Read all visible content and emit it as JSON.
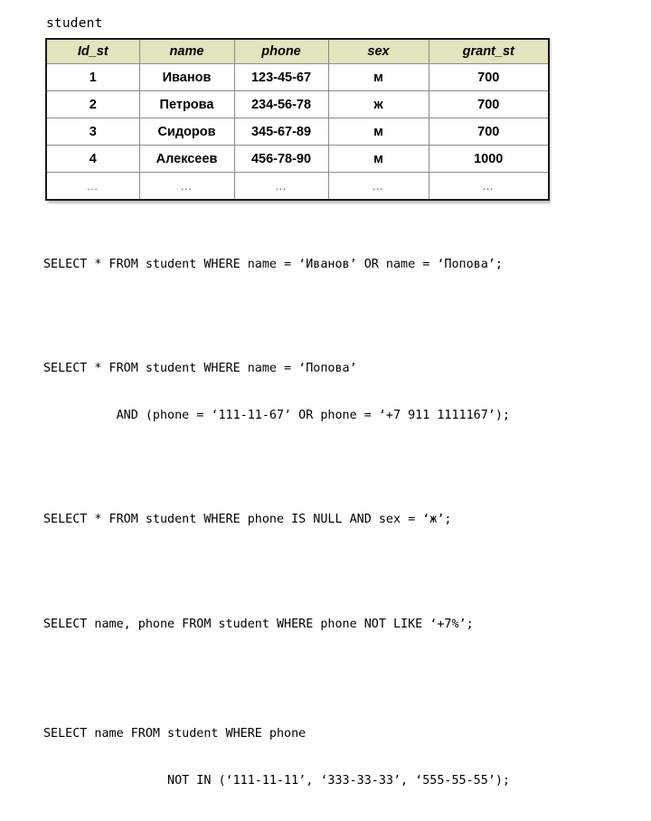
{
  "table": {
    "caption": "student",
    "columns": [
      "Id_st",
      "name",
      "phone",
      "sex",
      "grant_st"
    ],
    "rows": [
      [
        "1",
        "Иванов",
        "123-45-67",
        "м",
        "700"
      ],
      [
        "2",
        "Петрова",
        "234-56-78",
        "ж",
        "700"
      ],
      [
        "3",
        "Сидоров",
        "345-67-89",
        "м",
        "700"
      ],
      [
        "4",
        "Алексеев",
        "456-78-90",
        "м",
        "1000"
      ],
      [
        "…",
        "…",
        "…",
        "…",
        "…"
      ]
    ],
    "header_bg": "#e3e3bd",
    "border_color": "#1a1a1a",
    "cell_border_color": "#8a8a8a"
  },
  "sql": {
    "statements": [
      {
        "id": "stmt-1",
        "lines": [
          "SELECT * FROM student WHERE name = ‘Иванов’ OR name = ‘Попова’;"
        ]
      },
      {
        "id": "stmt-2",
        "lines": [
          "SELECT * FROM student WHERE name = ‘Попова’",
          "          AND (phone = ‘111-11-67’ OR phone = ‘+7 911 1111167’);"
        ]
      },
      {
        "id": "stmt-3",
        "lines": [
          "SELECT * FROM student WHERE phone IS NULL AND sex = ‘ж’;"
        ]
      },
      {
        "id": "stmt-4",
        "lines": [
          "SELECT name, phone FROM student WHERE phone NOT LIKE ‘+7%’;"
        ]
      },
      {
        "id": "stmt-5",
        "lines": [
          "SELECT name FROM student WHERE phone",
          "                 NOT IN (‘111-11-11’, ‘333-33-33’, ‘555-55-55’);"
        ]
      }
    ]
  }
}
